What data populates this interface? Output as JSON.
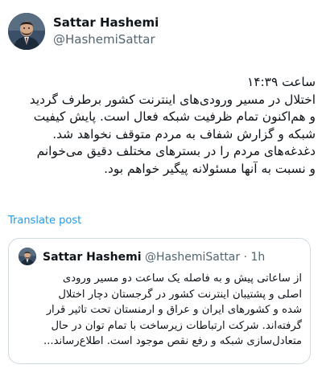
{
  "post": {
    "author": {
      "name": "Sattar Hashemi",
      "handle": "@HashemiSattar"
    },
    "body_lines": [
      "ساعت ۱۴:۳۹",
      "اختلال در مسیر ورودی‌های اینترنت کشور برطرف گردید",
      "و هم‌اکنون تمام ظرفیت شبکه فعال است. پایش کیفیت",
      "شبکه و گزارش شفاف به مردم متوقف نخواهد شد.",
      "دغدغه‌های مردم را در بسترهای مختلف دقیق می‌خوانم",
      "و نسبت به آنها مسئولانه پیگیر خواهم بود."
    ],
    "translate_label": "Translate post"
  },
  "quote": {
    "author": {
      "name": "Sattar Hashemi",
      "handle": "@HashemiSattar",
      "separator": " · ",
      "time": "1h"
    },
    "text_lines": [
      "از ساعاتی پیش و به فاصله یک ساعت دو مسیر ورودی",
      "اصلی و پشتیبان اینترنت کشور در گرجستان دچار اختلال",
      "شده و کشورهای ایران و عراق و ارمنستان تحت تاثیر قرار",
      "گرفته‌اند. شرکت ارتباطات زیرساخت با تمام توان در حال",
      "متعادل‌سازی شبکه و رفع نقص موجود است.  اطلاع‌رساند..."
    ]
  },
  "colors": {
    "link": "#1d9bf0",
    "secondary_text": "#536471",
    "border": "#cfd9de"
  }
}
